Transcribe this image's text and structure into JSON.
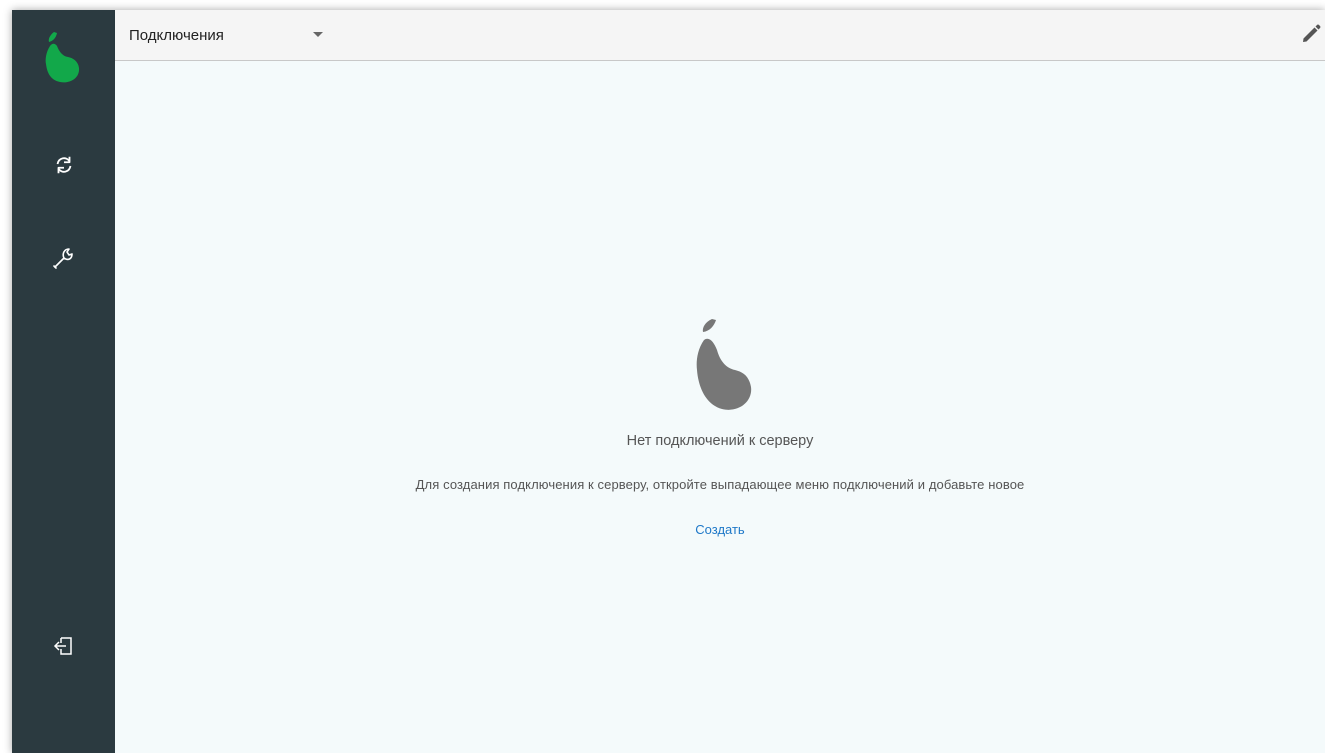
{
  "app": {
    "accent_color": "#12a84a",
    "sidebar_color": "#2b3a40"
  },
  "sidebar": {
    "logo_icon": "pear-logo-icon",
    "items": [
      {
        "icon": "sync-icon"
      },
      {
        "icon": "wrench-icon"
      }
    ],
    "logout_icon": "logout-icon"
  },
  "header": {
    "connections_label": "Подключения",
    "edit_icon": "pencil-icon"
  },
  "empty_state": {
    "icon": "pear-icon",
    "title": "Нет подключений к серверу",
    "description": "Для создания подключения к серверу, откройте выпадающее меню подключений и добавьте новое",
    "create_label": "Создать"
  }
}
